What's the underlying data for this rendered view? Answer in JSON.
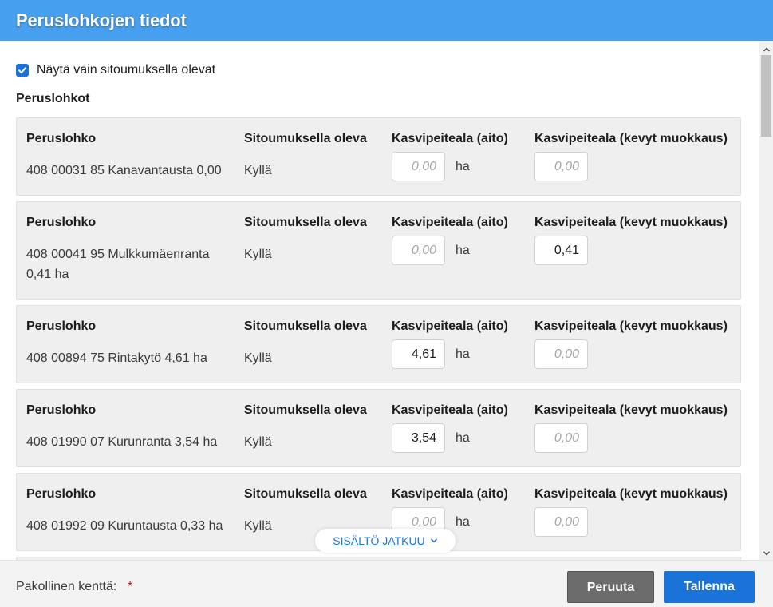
{
  "dialog": {
    "title": "Peruslohkojen tiedot"
  },
  "filter": {
    "label": "Näytä vain sitoumuksella olevat",
    "checked": true
  },
  "section_title": "Peruslohkot",
  "columns": {
    "parcel": "Peruslohko",
    "commitment": "Sitoumuksella oleva",
    "area_aito": "Kasvipeiteala (aito)",
    "area_kevyt": "Kasvipeiteala (kevyt muokkaus)"
  },
  "unit": "ha",
  "input_placeholder": "0,00",
  "parcels": [
    {
      "name": "408 00031 85 Kanavantausta  0,00",
      "commitment": "Kyllä",
      "aito": "",
      "kevyt": ""
    },
    {
      "name": "408 00041 95 Mulkkumäenranta  0,41 ha",
      "commitment": "Kyllä",
      "aito": "",
      "kevyt": "0,41"
    },
    {
      "name": "408 00894 75 Rintakytö  4,61 ha",
      "commitment": "Kyllä",
      "aito": "4,61",
      "kevyt": ""
    },
    {
      "name": "408 01990 07 Kurunranta  3,54 ha",
      "commitment": "Kyllä",
      "aito": "3,54",
      "kevyt": ""
    },
    {
      "name": "408 01992 09 Kuruntausta  0,33 ha",
      "commitment": "Kyllä",
      "aito": "",
      "kevyt": ""
    }
  ],
  "continue_label": "SISÄLTÖ JATKUU",
  "footer": {
    "required_label": "Pakollinen kenttä:",
    "required_marker": "*",
    "cancel_label": "Peruuta",
    "save_label": "Tallenna"
  },
  "colors": {
    "header": "#47a0ef",
    "primary": "#1a73d9",
    "cancel": "#6c6c6c",
    "required": "#d0021b"
  },
  "icons": {
    "checkbox": "checkmark-icon",
    "continue": "chevron-down-icon",
    "scroll_up": "chevron-up-icon",
    "scroll_down": "chevron-down-icon"
  }
}
